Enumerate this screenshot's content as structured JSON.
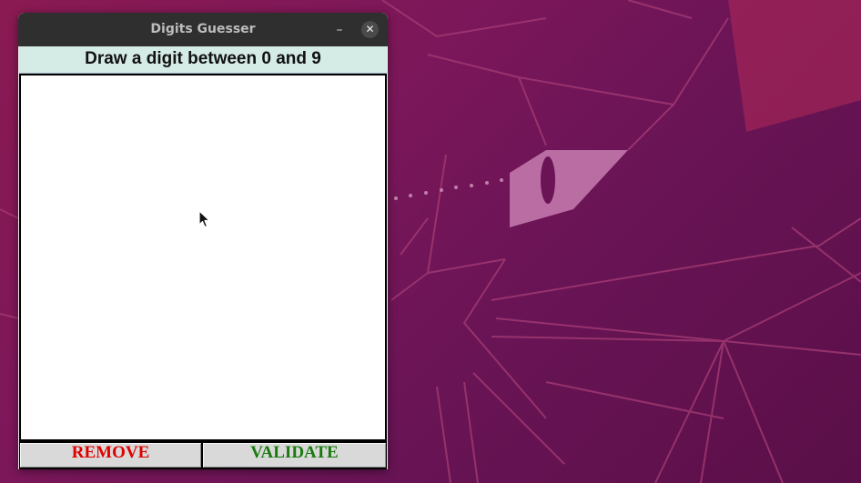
{
  "window": {
    "title": "Digits Guesser",
    "minimize_glyph": "–",
    "close_glyph": "✕"
  },
  "header": {
    "text": "Draw a digit between 0 and 9"
  },
  "buttons": {
    "remove_label": "REMOVE",
    "validate_label": "VALIDATE",
    "remove_color": "#e00000",
    "validate_color": "#1a7a10"
  },
  "colors": {
    "header_bg": "#d5ebe6",
    "titlebar_bg": "#2f2f2f",
    "canvas_bg": "#ffffff",
    "desktop_bg": "#7c175a"
  },
  "icons": {
    "cursor": "arrow-pointer-icon",
    "minimize": "minimize-icon",
    "close": "close-icon"
  }
}
